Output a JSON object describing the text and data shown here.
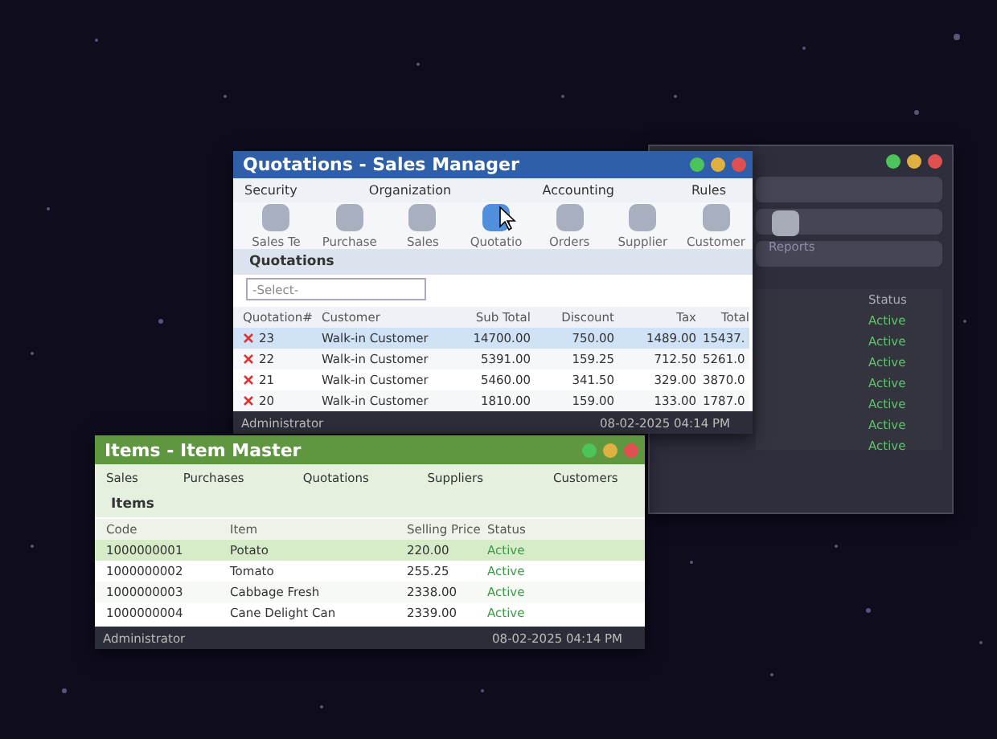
{
  "back_window": {
    "icon_label": "Reports",
    "status_header": "Status",
    "statuses": [
      "Active",
      "Active",
      "Active",
      "Active",
      "Active",
      "Active",
      "Active"
    ]
  },
  "quotations_window": {
    "title": "Quotations - Sales Manager",
    "menu": [
      "Security",
      "Organization",
      "Accounting",
      "Rules"
    ],
    "modules": [
      {
        "label": "Sales Te",
        "selected": false
      },
      {
        "label": "Purchase",
        "selected": false
      },
      {
        "label": "Sales",
        "selected": false
      },
      {
        "label": "Quotatio",
        "selected": true
      },
      {
        "label": "Orders",
        "selected": false
      },
      {
        "label": "Supplier",
        "selected": false
      },
      {
        "label": "Customer",
        "selected": false
      }
    ],
    "section": "Quotations",
    "filter": {
      "placeholder": "-Select-"
    },
    "columns": [
      "Quotation#",
      "Customer",
      "Sub Total",
      "Discount",
      "Tax",
      "Total"
    ],
    "rows": [
      {
        "cells": [
          "23",
          "Walk-in Customer",
          "14700.00",
          "750.00",
          "1489.00",
          "15437."
        ],
        "selected": true
      },
      {
        "cells": [
          "22",
          "Walk-in Customer",
          "5391.00",
          "159.25",
          "712.50",
          "5261.0"
        ],
        "selected": false
      },
      {
        "cells": [
          "21",
          "Walk-in Customer",
          "5460.00",
          "341.50",
          "329.00",
          "3870.0"
        ],
        "selected": false
      },
      {
        "cells": [
          "20",
          "Walk-in Customer",
          "1810.00",
          "159.00",
          "133.00",
          "1787.0"
        ],
        "selected": false
      }
    ],
    "status_user": "Administrator",
    "status_time": "08-02-2025 04:14 PM"
  },
  "items_window": {
    "title": "Items - Item Master",
    "menu": [
      "Sales",
      "Purchases",
      "Quotations",
      "Suppliers",
      "Customers"
    ],
    "section": "Items",
    "columns": [
      "Code",
      "Item",
      "Selling Price",
      "Status"
    ],
    "rows": [
      {
        "cells": [
          "1000000001",
          "Potato",
          "220.00",
          "Active"
        ],
        "selected": true
      },
      {
        "cells": [
          "1000000002",
          "Tomato",
          "255.25",
          "Active"
        ],
        "selected": false
      },
      {
        "cells": [
          "1000000003",
          "Cabbage Fresh",
          "2338.00",
          "Active"
        ],
        "selected": false
      },
      {
        "cells": [
          "1000000004",
          "Cane Delight Can",
          "2339.00",
          "Active"
        ],
        "selected": false
      }
    ],
    "status_user": "Administrator",
    "status_time": "08-02-2025 04:14 PM"
  }
}
